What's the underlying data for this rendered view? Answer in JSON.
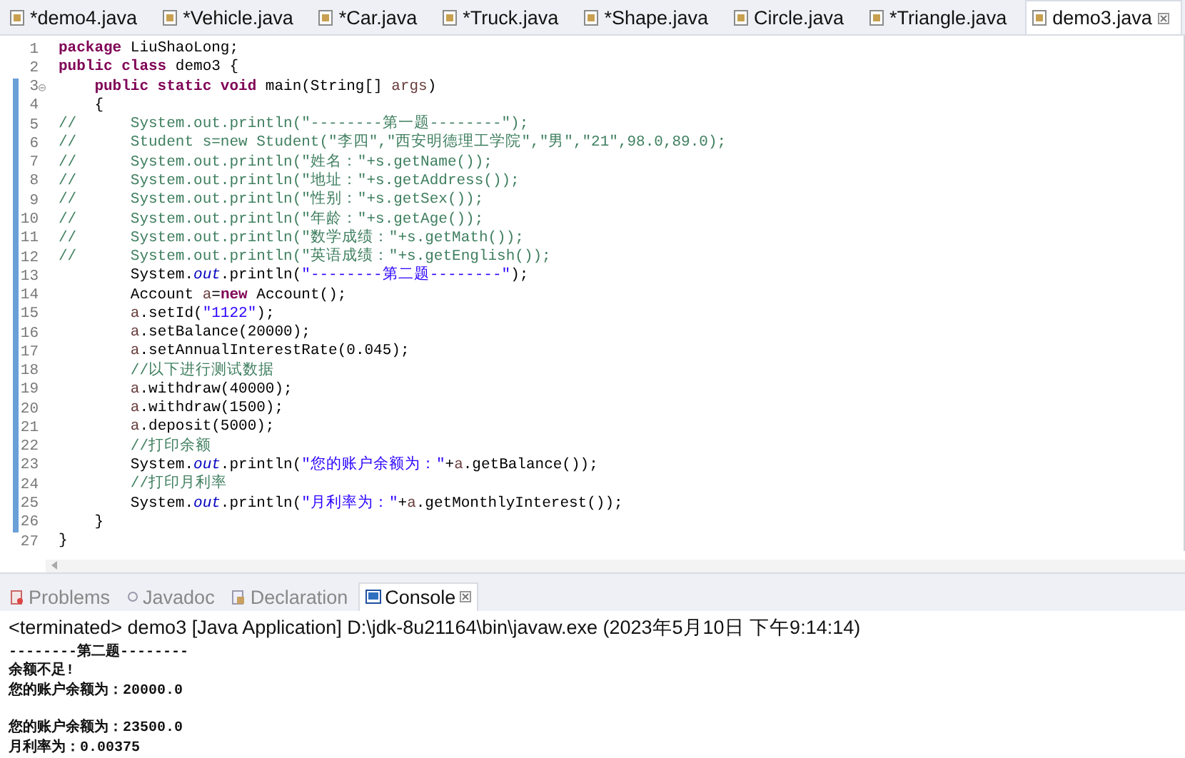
{
  "editor_tabs": [
    {
      "label": "*demo4.java",
      "selected": false
    },
    {
      "label": "*Vehicle.java",
      "selected": false
    },
    {
      "label": "*Car.java",
      "selected": false
    },
    {
      "label": "*Truck.java",
      "selected": false
    },
    {
      "label": "*Shape.java",
      "selected": false
    },
    {
      "label": "Circle.java",
      "selected": false
    },
    {
      "label": "*Triangle.java",
      "selected": false
    },
    {
      "label": "demo3.java",
      "selected": true
    }
  ],
  "code_lines": [
    {
      "number": "1",
      "changed": false,
      "foldable": false,
      "tokens": [
        {
          "kind": "keyword",
          "text": "package"
        },
        {
          "kind": "plain",
          "text": " LiuShaoLong;"
        }
      ]
    },
    {
      "number": "2",
      "changed": false,
      "foldable": false,
      "tokens": [
        {
          "kind": "keyword",
          "text": "public class"
        },
        {
          "kind": "plain",
          "text": " demo3 {"
        }
      ]
    },
    {
      "number": "3",
      "changed": true,
      "foldable": true,
      "tokens": [
        {
          "kind": "keyword",
          "text": "    public static void"
        },
        {
          "kind": "plain",
          "text": " main(String[] "
        },
        {
          "kind": "variable",
          "text": "args"
        },
        {
          "kind": "plain",
          "text": ")"
        }
      ]
    },
    {
      "number": "4",
      "changed": true,
      "foldable": false,
      "tokens": [
        {
          "kind": "plain",
          "text": "    {"
        }
      ]
    },
    {
      "number": "5",
      "changed": true,
      "foldable": false,
      "tokens": [
        {
          "kind": "comment",
          "text": "//      System.out.println(\"--------第一题--------\");"
        }
      ]
    },
    {
      "number": "6",
      "changed": true,
      "foldable": false,
      "tokens": [
        {
          "kind": "comment",
          "text": "//      Student s=new Student(\"李四\",\"西安明德理工学院\",\"男\",\"21\",98.0,89.0);"
        }
      ]
    },
    {
      "number": "7",
      "changed": true,
      "foldable": false,
      "tokens": [
        {
          "kind": "comment",
          "text": "//      System.out.println(\"姓名：\"+s.getName());"
        }
      ]
    },
    {
      "number": "8",
      "changed": true,
      "foldable": false,
      "tokens": [
        {
          "kind": "comment",
          "text": "//      System.out.println(\"地址：\"+s.getAddress());"
        }
      ]
    },
    {
      "number": "9",
      "changed": true,
      "foldable": false,
      "tokens": [
        {
          "kind": "comment",
          "text": "//      System.out.println(\"性别：\"+s.getSex());"
        }
      ]
    },
    {
      "number": "10",
      "changed": true,
      "foldable": false,
      "tokens": [
        {
          "kind": "comment",
          "text": "//      System.out.println(\"年龄：\"+s.getAge());"
        }
      ]
    },
    {
      "number": "11",
      "changed": true,
      "foldable": false,
      "tokens": [
        {
          "kind": "comment",
          "text": "//      System.out.println(\"数学成绩：\"+s.getMath());"
        }
      ]
    },
    {
      "number": "12",
      "changed": true,
      "foldable": false,
      "tokens": [
        {
          "kind": "comment",
          "text": "//      System.out.println(\"英语成绩：\"+s.getEnglish());"
        }
      ]
    },
    {
      "number": "13",
      "changed": true,
      "foldable": false,
      "tokens": [
        {
          "kind": "plain",
          "text": "        System."
        },
        {
          "kind": "field",
          "text": "out"
        },
        {
          "kind": "plain",
          "text": ".println("
        },
        {
          "kind": "string",
          "text": "\"--------第二题--------\""
        },
        {
          "kind": "plain",
          "text": ");"
        }
      ]
    },
    {
      "number": "14",
      "changed": true,
      "foldable": false,
      "tokens": [
        {
          "kind": "plain",
          "text": "        Account "
        },
        {
          "kind": "variable",
          "text": "a"
        },
        {
          "kind": "plain",
          "text": "="
        },
        {
          "kind": "keyword",
          "text": "new"
        },
        {
          "kind": "plain",
          "text": " Account();"
        }
      ]
    },
    {
      "number": "15",
      "changed": true,
      "foldable": false,
      "tokens": [
        {
          "kind": "variable",
          "text": "        a"
        },
        {
          "kind": "plain",
          "text": ".setId("
        },
        {
          "kind": "string",
          "text": "\"1122\""
        },
        {
          "kind": "plain",
          "text": ");"
        }
      ]
    },
    {
      "number": "16",
      "changed": true,
      "foldable": false,
      "tokens": [
        {
          "kind": "variable",
          "text": "        a"
        },
        {
          "kind": "plain",
          "text": ".setBalance(20000);"
        }
      ]
    },
    {
      "number": "17",
      "changed": true,
      "foldable": false,
      "tokens": [
        {
          "kind": "variable",
          "text": "        a"
        },
        {
          "kind": "plain",
          "text": ".setAnnualInterestRate(0.045);"
        }
      ]
    },
    {
      "number": "18",
      "changed": true,
      "foldable": false,
      "tokens": [
        {
          "kind": "comment",
          "text": "        //以下进行测试数据"
        }
      ]
    },
    {
      "number": "19",
      "changed": true,
      "foldable": false,
      "tokens": [
        {
          "kind": "variable",
          "text": "        a"
        },
        {
          "kind": "plain",
          "text": ".withdraw(40000);"
        }
      ]
    },
    {
      "number": "20",
      "changed": true,
      "foldable": false,
      "tokens": [
        {
          "kind": "variable",
          "text": "        a"
        },
        {
          "kind": "plain",
          "text": ".withdraw(1500);"
        }
      ]
    },
    {
      "number": "21",
      "changed": true,
      "foldable": false,
      "tokens": [
        {
          "kind": "variable",
          "text": "        a"
        },
        {
          "kind": "plain",
          "text": ".deposit(5000);"
        }
      ]
    },
    {
      "number": "22",
      "changed": true,
      "foldable": false,
      "tokens": [
        {
          "kind": "comment",
          "text": "        //打印余额"
        }
      ]
    },
    {
      "number": "23",
      "changed": true,
      "foldable": false,
      "tokens": [
        {
          "kind": "plain",
          "text": "        System."
        },
        {
          "kind": "field",
          "text": "out"
        },
        {
          "kind": "plain",
          "text": ".println("
        },
        {
          "kind": "string",
          "text": "\"您的账户余额为：\""
        },
        {
          "kind": "plain",
          "text": "+"
        },
        {
          "kind": "variable",
          "text": "a"
        },
        {
          "kind": "plain",
          "text": ".getBalance());"
        }
      ]
    },
    {
      "number": "24",
      "changed": true,
      "foldable": false,
      "tokens": [
        {
          "kind": "comment",
          "text": "        //打印月利率"
        }
      ]
    },
    {
      "number": "25",
      "changed": true,
      "foldable": false,
      "tokens": [
        {
          "kind": "plain",
          "text": "        System."
        },
        {
          "kind": "field",
          "text": "out"
        },
        {
          "kind": "plain",
          "text": ".println("
        },
        {
          "kind": "string",
          "text": "\"月利率为：\""
        },
        {
          "kind": "plain",
          "text": "+"
        },
        {
          "kind": "variable",
          "text": "a"
        },
        {
          "kind": "plain",
          "text": ".getMonthlyInterest());"
        }
      ]
    },
    {
      "number": "26",
      "changed": true,
      "foldable": false,
      "tokens": [
        {
          "kind": "plain",
          "text": "    }"
        }
      ]
    },
    {
      "number": "27",
      "changed": false,
      "foldable": false,
      "tokens": [
        {
          "kind": "plain",
          "text": "}"
        }
      ]
    }
  ],
  "view_tabs": [
    {
      "label": "Problems",
      "selected": false
    },
    {
      "label": "Javadoc",
      "selected": false
    },
    {
      "label": "Declaration",
      "selected": false
    },
    {
      "label": "Console",
      "selected": true
    }
  ],
  "console": {
    "header": "<terminated> demo3 [Java Application] D:\\jdk-8u21164\\bin\\javaw.exe (2023年5月10日 下午9:14:14)",
    "output": [
      {
        "text": "--------第二题--------",
        "gap_before": false
      },
      {
        "text": "余额不足!",
        "gap_before": false
      },
      {
        "text": "您的账户余额为：20000.0",
        "gap_before": false
      },
      {
        "text": "您的账户余额为：23500.0",
        "gap_before": true
      },
      {
        "text": "月利率为：0.00375",
        "gap_before": false
      }
    ]
  }
}
